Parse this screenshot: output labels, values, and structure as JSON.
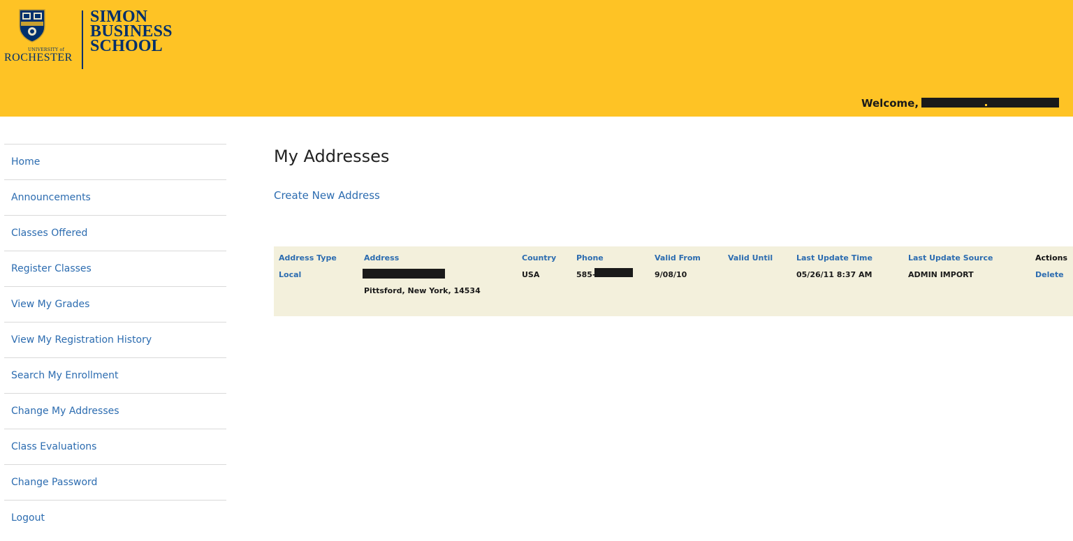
{
  "header": {
    "university_small": "UNIVERSITY of",
    "university_name": "ROCHESTER",
    "school_lines": [
      "SIMON",
      "BUSINESS",
      "SCHOOL"
    ],
    "welcome_label": "Welcome,"
  },
  "sidebar": {
    "items": [
      {
        "label": "Home"
      },
      {
        "label": "Announcements"
      },
      {
        "label": "Classes Offered"
      },
      {
        "label": "Register Classes"
      },
      {
        "label": "View My Grades"
      },
      {
        "label": "View My Registration History"
      },
      {
        "label": "Search My Enrollment"
      },
      {
        "label": "Change My Addresses"
      },
      {
        "label": "Class Evaluations"
      },
      {
        "label": "Change Password"
      },
      {
        "label": "Logout"
      }
    ]
  },
  "main": {
    "title": "My Addresses",
    "create_link": "Create New Address",
    "table": {
      "headers": {
        "address_type": "Address Type",
        "address": "Address",
        "country": "Country",
        "phone": "Phone",
        "valid_from": "Valid From",
        "valid_until": "Valid Until",
        "last_update_time": "Last Update Time",
        "last_update_source": "Last Update Source",
        "actions": "Actions"
      },
      "rows": [
        {
          "address_type": "Local",
          "address_line2": "Pittsford, New York, 14534",
          "country": "USA",
          "phone_prefix": "585-",
          "valid_from": "9/08/10",
          "valid_until": "",
          "last_update_time": "05/26/11 8:37 AM",
          "last_update_source": "ADMIN IMPORT",
          "action": "Delete"
        }
      ]
    }
  },
  "colors": {
    "header_bg": "#fec325",
    "brand_navy": "#002f6c",
    "link_blue": "#2c6cb0",
    "table_bg": "#f3f0dc"
  }
}
